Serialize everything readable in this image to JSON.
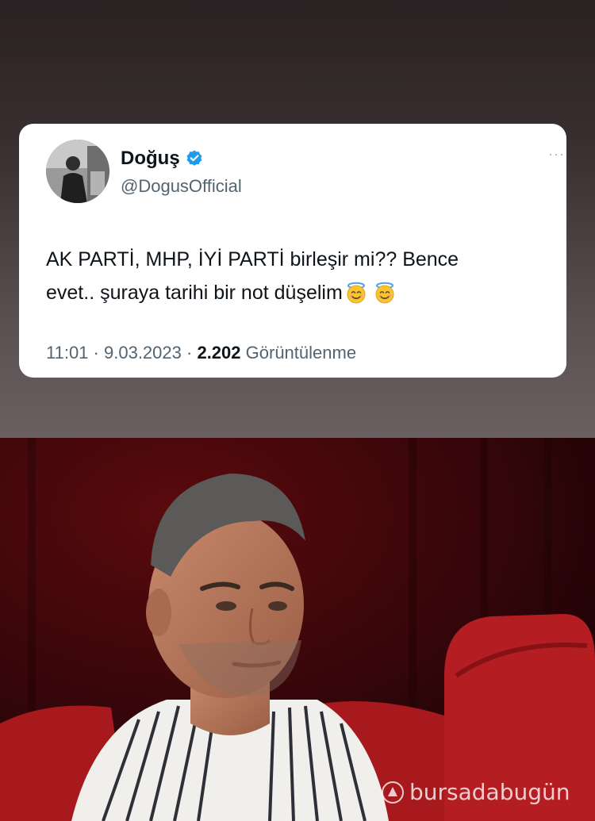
{
  "tweet": {
    "display_name": "Doğuş",
    "handle": "@DogusOfficial",
    "text_line1": "AK PARTİ, MHP, İYİ PARTİ birleşir mi?? Bence",
    "text_line2": "evet.. şuraya tarihi bir not düşelim",
    "emoji": "smiling-face-with-halo",
    "time": "11:01",
    "date": "9.03.2023",
    "views_count": "2.202",
    "views_label": "Görüntülenme",
    "separator": "·",
    "more_glyph": "···"
  },
  "watermark": {
    "text": "bursadabugün"
  },
  "colors": {
    "verified_blue": "#1d9bf0",
    "text_primary": "#0f1419",
    "text_secondary": "#536471",
    "chair_red": "#b41d22",
    "curtain_dark_red": "#3a0608"
  }
}
